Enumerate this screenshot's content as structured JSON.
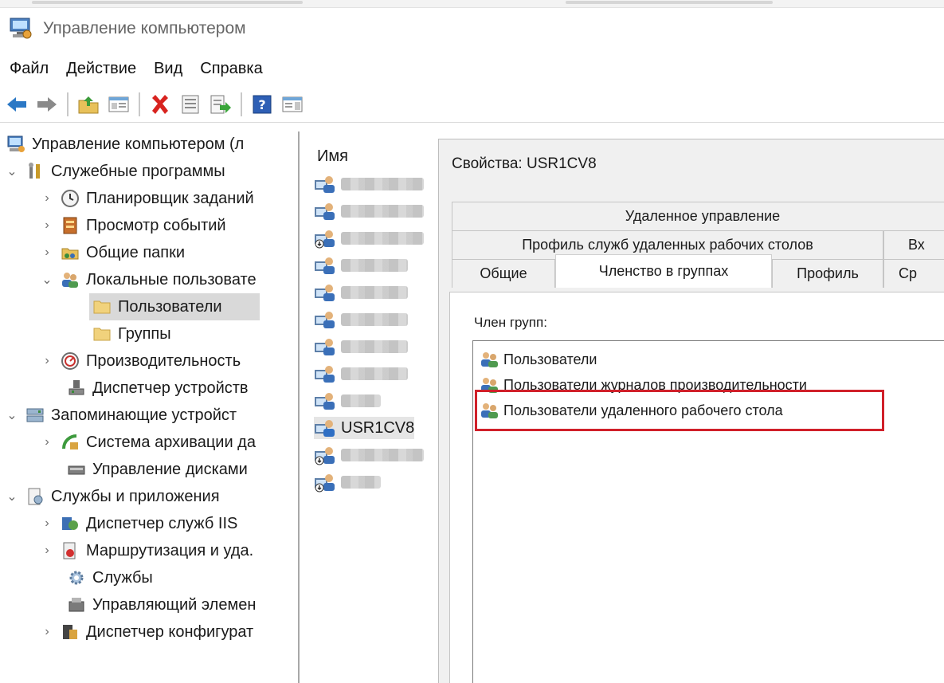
{
  "window": {
    "title": "Управление компьютером"
  },
  "menu": [
    "Файл",
    "Действие",
    "Вид",
    "Справка"
  ],
  "toolbar": {
    "buttons": [
      "back-arrow-icon",
      "forward-arrow-icon",
      "up-folder-icon",
      "show-hide-tree-icon",
      "delete-icon",
      "properties-icon",
      "export-list-icon",
      "help-icon",
      "action-pane-icon"
    ]
  },
  "tree": [
    {
      "label": "Управление компьютером (л",
      "icon": "computer-management-icon",
      "level": 0,
      "chevron": ""
    },
    {
      "label": "Служебные программы",
      "icon": "tools-icon",
      "level": 0,
      "chevron": "expanded"
    },
    {
      "label": "Планировщик заданий",
      "icon": "clock-icon",
      "level": 1,
      "chevron": "collapsed"
    },
    {
      "label": "Просмотр событий",
      "icon": "event-viewer-icon",
      "level": 1,
      "chevron": "collapsed"
    },
    {
      "label": "Общие папки",
      "icon": "shared-folder-icon",
      "level": 1,
      "chevron": "collapsed"
    },
    {
      "label": "Локальные пользовате",
      "icon": "users-icon",
      "level": 1,
      "chevron": "expanded"
    },
    {
      "label": "Пользователи",
      "icon": "folder-icon",
      "level": 2,
      "chevron": "",
      "selected": true
    },
    {
      "label": "Группы",
      "icon": "folder-icon",
      "level": 2,
      "chevron": ""
    },
    {
      "label": "Производительность",
      "icon": "performance-icon",
      "level": 1,
      "chevron": "collapsed"
    },
    {
      "label": "Диспетчер устройств",
      "icon": "device-manager-icon",
      "level": 1,
      "chevron": ""
    },
    {
      "label": "Запоминающие устройст",
      "icon": "storage-icon",
      "level": 0,
      "chevron": "expanded"
    },
    {
      "label": "Система архивации да",
      "icon": "backup-icon",
      "level": 1,
      "chevron": "collapsed"
    },
    {
      "label": "Управление дисками",
      "icon": "disk-icon",
      "level": 1,
      "chevron": ""
    },
    {
      "label": "Службы и приложения",
      "icon": "services-apps-icon",
      "level": 0,
      "chevron": "expanded"
    },
    {
      "label": "Диспетчер служб IIS",
      "icon": "iis-icon",
      "level": 1,
      "chevron": "collapsed"
    },
    {
      "label": "Маршрутизация и уда.",
      "icon": "routing-icon",
      "level": 1,
      "chevron": "collapsed"
    },
    {
      "label": "Службы",
      "icon": "gear-icon",
      "level": 1,
      "chevron": ""
    },
    {
      "label": "Управляющий элемен",
      "icon": "wmi-icon",
      "level": 1,
      "chevron": ""
    },
    {
      "label": "Диспетчер конфигурат",
      "icon": "config-manager-icon",
      "level": 1,
      "chevron": "collapsed"
    }
  ],
  "userlist": {
    "header": "Имя",
    "rows": [
      {
        "name": "",
        "disabled": false
      },
      {
        "name": "",
        "disabled": false
      },
      {
        "name": "",
        "disabled": true
      },
      {
        "name": "",
        "disabled": false
      },
      {
        "name": "",
        "disabled": false
      },
      {
        "name": "",
        "disabled": false
      },
      {
        "name": "",
        "disabled": false
      },
      {
        "name": "",
        "disabled": false
      },
      {
        "name": "",
        "disabled": false
      },
      {
        "name": "USR1CV8",
        "disabled": false,
        "selected": true
      },
      {
        "name": "",
        "disabled": true
      },
      {
        "name": "",
        "disabled": true
      }
    ]
  },
  "dialog": {
    "title": "Свойства: USR1CV8",
    "tab_rows": [
      [
        "Удаленное управление"
      ],
      [
        "Профиль служб удаленных рабочих столов",
        "Вх"
      ],
      [
        "Общие",
        "Членство в группах",
        "Профиль",
        "Ср"
      ]
    ],
    "active_tab": "Членство в группах",
    "member_of_label": "Член групп:",
    "groups": [
      "Пользователи",
      "Пользователи журналов производительности",
      "Пользователи удаленного рабочего стола"
    ],
    "highlighted_group": "Пользователи удаленного рабочего стола"
  },
  "colors": {
    "highlight_box": "#d0202a",
    "selected_row": "#d9d9d9",
    "dialog_bg": "#f0f0f0"
  }
}
